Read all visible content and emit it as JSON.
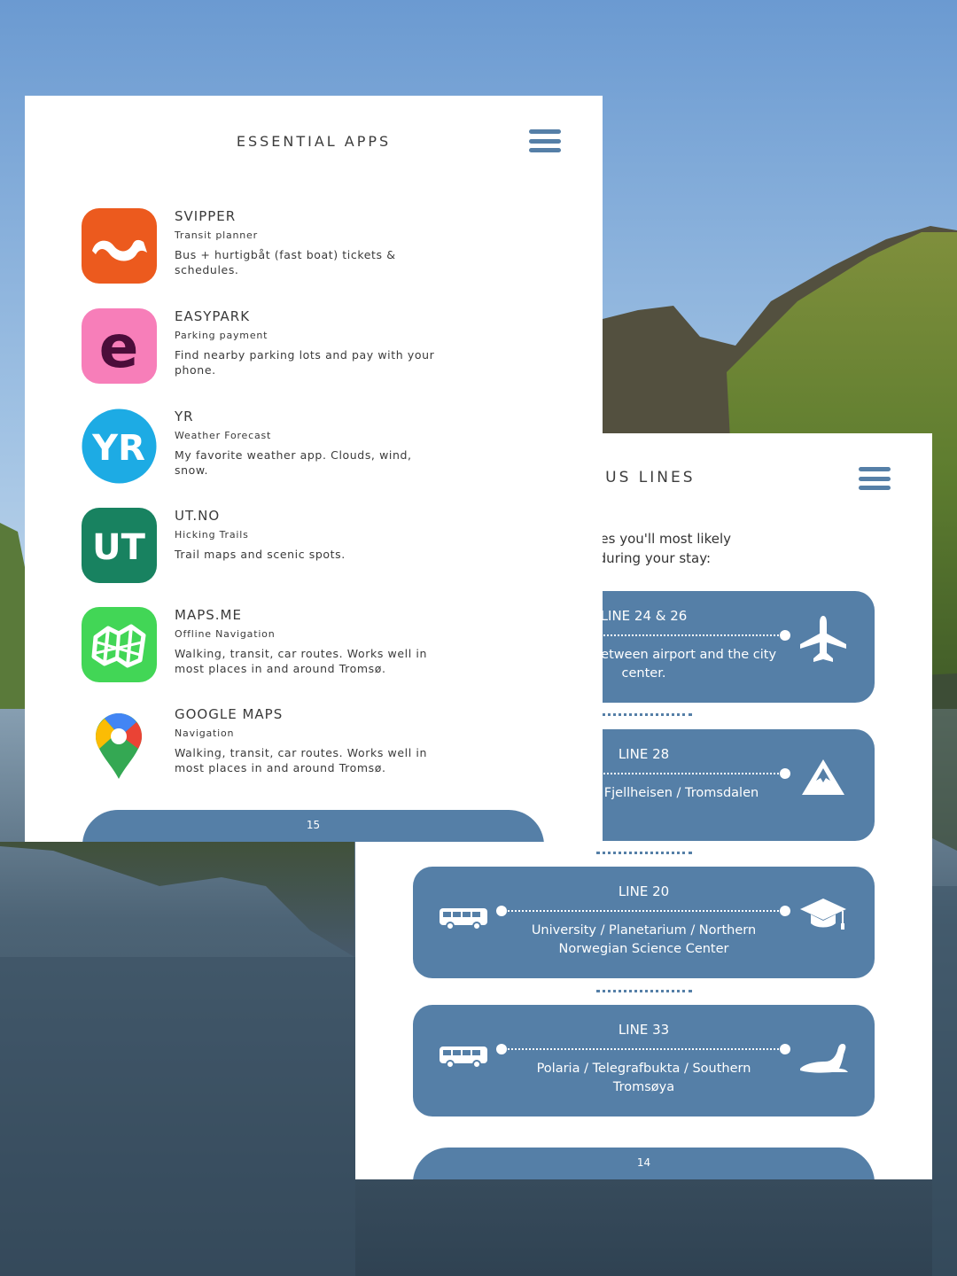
{
  "colors": {
    "accent": "#557fa7",
    "svipper": "#ec5a1e",
    "easypark": "#f77eb9",
    "yr": "#1dabe4",
    "ut": "#188260",
    "mapsme": "#42d656"
  },
  "bus_page": {
    "title": "BUS LINES",
    "intro_line1": "bus lines you'll most likely",
    "intro_line2": "ful during your stay:",
    "lines": [
      {
        "name": "LINE 24 & 26",
        "desc": "connections between airport and the city center.",
        "icon": "airplane-icon"
      },
      {
        "name": "LINE 28",
        "desc": "Cathedral / Fjellheisen / Tromsdalen",
        "icon": "mountain-icon"
      },
      {
        "name": "LINE 20",
        "desc": "University / Planetarium / Northern Norwegian Science Center",
        "icon": "graduation-cap-icon"
      },
      {
        "name": "LINE 33",
        "desc": "Polaria / Telegrafbukta / Southern Tromsøya",
        "icon": "seal-icon"
      }
    ],
    "page_number": "14"
  },
  "apps_page": {
    "title": "ESSENTIAL APPS",
    "apps": [
      {
        "name": "SVIPPER",
        "category": "Transit planner",
        "desc": "Bus + hurtigbåt (fast boat) tickets & schedules.",
        "icon": "svipper-icon"
      },
      {
        "name": "EASYPARK",
        "category": "Parking payment",
        "desc": "Find nearby parking lots and pay with your phone.",
        "icon": "easypark-icon",
        "glyph": "e"
      },
      {
        "name": "YR",
        "category": "Weather Forecast",
        "desc": "My favorite weather app. Clouds, wind, snow.",
        "icon": "yr-icon",
        "glyph": "YR"
      },
      {
        "name": "UT.NO",
        "category": "Hicking Trails",
        "desc": "Trail maps and scenic spots.",
        "icon": "ut-icon",
        "glyph": "UT"
      },
      {
        "name": "MAPS.ME",
        "category": "Offline Navigation",
        "desc": "Walking, transit, car routes. Works well in most places in and around Tromsø.",
        "icon": "mapsme-icon"
      },
      {
        "name": "GOOGLE MAPS",
        "category": "Navigation",
        "desc": "Walking, transit, car routes. Works well in most places in and around Tromsø.",
        "icon": "google-maps-icon"
      }
    ],
    "page_number": "15"
  }
}
